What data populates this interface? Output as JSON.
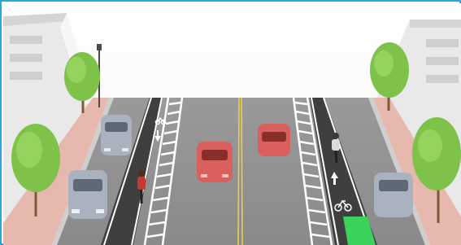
{
  "scene": {
    "subject": "street-cross-section-with-protected-bike-lanes",
    "colors": {
      "frame_border": "#29a8df",
      "asphalt": "#8c8c8c",
      "bike_lane": "#3f3f3f",
      "bike_box": "#3bd15a",
      "center_line": "#f2d23b",
      "sidewalk": "#e7b8ad",
      "car_red": "#d9605c",
      "car_silver": "#aab2bf",
      "tree": "#7ec24a"
    },
    "icons": [
      "bicycle-marking-icon",
      "arrow-up-icon"
    ]
  }
}
